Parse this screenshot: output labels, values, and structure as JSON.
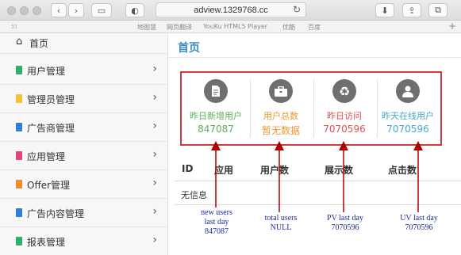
{
  "browser": {
    "url": "adview.1329768.cc",
    "bookmarks": [
      "地图慧",
      "网页翻译",
      "YouKu HTML5 Player",
      "优酷",
      "百度"
    ]
  },
  "sidebar": {
    "home": "首页",
    "items": [
      {
        "label": "用户管理",
        "color": "#2eaf6b"
      },
      {
        "label": "管理员管理",
        "color": "#f2c134"
      },
      {
        "label": "广告商管理",
        "color": "#2f7fd6"
      },
      {
        "label": "应用管理",
        "color": "#e8417f"
      },
      {
        "label": "Offer管理",
        "color": "#f08a2b"
      },
      {
        "label": "广告内容管理",
        "color": "#2f7fd6"
      },
      {
        "label": "报表管理",
        "color": "#2eaf6b"
      }
    ]
  },
  "main": {
    "title": "首页",
    "stats": [
      {
        "title": "昨日新增用户",
        "value": "847087",
        "color": "#5db15a",
        "icon": "document-icon"
      },
      {
        "title": "用户总数",
        "value": "暂无数据",
        "color": "#f0962e",
        "icon": "briefcase-icon"
      },
      {
        "title": "昨日访问",
        "value": "7070596",
        "color": "#d9534f",
        "icon": "recycle-icon"
      },
      {
        "title": "昨天在线用户",
        "value": "7070596",
        "color": "#46a9c9",
        "icon": "user-icon"
      }
    ],
    "table": {
      "headers": [
        "ID",
        "应用",
        "用户数",
        "展示数",
        "点击数"
      ],
      "empty": "无信息"
    }
  },
  "annotations": [
    {
      "lines": [
        "new users",
        "last day",
        "847087"
      ]
    },
    {
      "lines": [
        "total users",
        "NULL"
      ]
    },
    {
      "lines": [
        "PV  last day",
        "7070596"
      ]
    },
    {
      "lines": [
        "UV  last day",
        "7070596"
      ]
    }
  ],
  "colors": {
    "accent": "#3a8ec5",
    "highlight_box": "#cf3a3a",
    "annotation": "#1c2aa0"
  }
}
